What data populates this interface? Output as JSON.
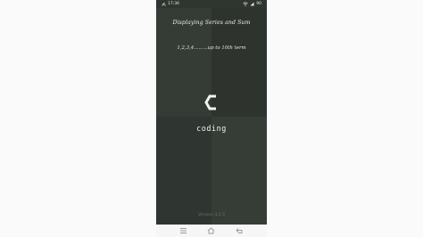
{
  "status_bar": {
    "time": "17:36",
    "battery_level": "90"
  },
  "overlay": {
    "title": "Displaying Series and Sum",
    "subtitle": "1,2,3,4.........up to 10th term"
  },
  "splash": {
    "logo_text": "coding",
    "version": "Version 3.2.5"
  },
  "nav_bar": {
    "buttons": [
      "menu-icon",
      "home-icon",
      "back-icon"
    ]
  },
  "colors": {
    "background": "#333a34",
    "text": "#f2f4ef",
    "version_text": "#69706a",
    "nav_bar": "#f6f6f6"
  }
}
